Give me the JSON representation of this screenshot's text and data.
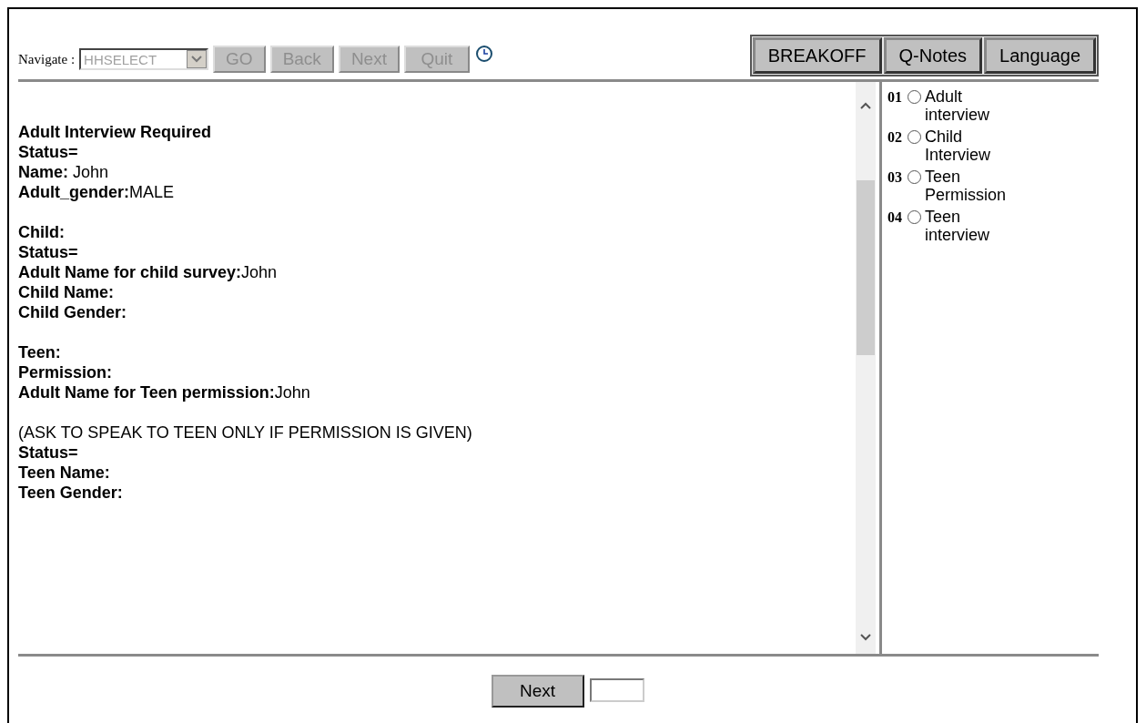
{
  "navigation": {
    "label": "Navigate :",
    "select_value": "HHSELECT",
    "select_disabled": true,
    "buttons": [
      {
        "label": "GO",
        "disabled": true
      },
      {
        "label": "Back",
        "disabled": true
      },
      {
        "label": "Next",
        "disabled": true
      },
      {
        "label": "Quit",
        "disabled": true
      }
    ]
  },
  "actions": [
    {
      "label": "BREAKOFF"
    },
    {
      "label": "Q-Notes"
    },
    {
      "label": "Language"
    }
  ],
  "sections": [
    {
      "lines": [
        {
          "kind": "heading",
          "label": "Adult Interview Required"
        },
        {
          "kind": "field",
          "label": "Status="
        },
        {
          "kind": "field",
          "label": "Name:",
          "value": " John"
        },
        {
          "kind": "field",
          "label": "Adult_gender:",
          "value": "MALE"
        }
      ]
    },
    {
      "lines": [
        {
          "kind": "heading",
          "label": "Child:"
        },
        {
          "kind": "field",
          "label": "Status="
        },
        {
          "kind": "field",
          "label": "Adult Name for child survey:",
          "value": "John"
        },
        {
          "kind": "field",
          "label": "Child Name:"
        },
        {
          "kind": "field",
          "label": "Child Gender:"
        }
      ]
    },
    {
      "lines": [
        {
          "kind": "heading",
          "label": "Teen:"
        },
        {
          "kind": "field",
          "label": "Permission:"
        },
        {
          "kind": "field",
          "label": "Adult Name for Teen permission:",
          "value": "John"
        }
      ]
    },
    {
      "lines": [
        {
          "kind": "note",
          "label": "(ASK TO SPEAK TO TEEN ONLY IF PERMISSION IS GIVEN)"
        },
        {
          "kind": "field",
          "label": "Status="
        },
        {
          "kind": "field",
          "label": "Teen Name:"
        },
        {
          "kind": "field",
          "label": "Teen Gender:"
        }
      ]
    }
  ],
  "options": [
    {
      "code": "01",
      "label": "Adult interview",
      "selected": false
    },
    {
      "code": "02",
      "label": "Child Interview",
      "selected": false
    },
    {
      "code": "03",
      "label": "Teen Permission",
      "selected": false
    },
    {
      "code": "04",
      "label": "Teen interview",
      "selected": false
    }
  ],
  "footer": {
    "button": "Next"
  }
}
